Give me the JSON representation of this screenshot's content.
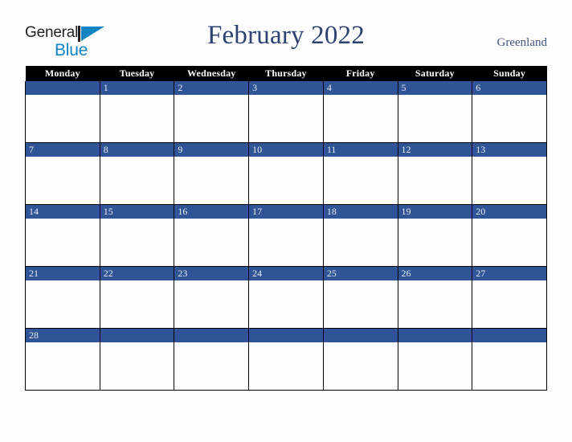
{
  "branding": {
    "logo_text_top": "General",
    "logo_text_bottom": "Blue",
    "logo_mark": "blue-triangle-icon",
    "color_dark": "#231f20",
    "color_blue": "#1283c3"
  },
  "header": {
    "title": "February 2022",
    "month": "February",
    "year": "2022",
    "country": "Greenland"
  },
  "theme": {
    "header_row_bg": "#000000",
    "header_row_text": "#ffffff",
    "date_band_bg": "#2f5597",
    "date_band_text": "#e8eaf0",
    "cell_bg": "#fdfdfd",
    "grid_line": "#000000",
    "page_bg": "#fdfdfd",
    "title_color": "#2e4272"
  },
  "calendar": {
    "weekday_headers": [
      "Monday",
      "Tuesday",
      "Wednesday",
      "Thursday",
      "Friday",
      "Saturday",
      "Sunday"
    ],
    "weeks": [
      {
        "days": [
          {
            "num": ""
          },
          {
            "num": "1"
          },
          {
            "num": "2"
          },
          {
            "num": "3"
          },
          {
            "num": "4"
          },
          {
            "num": "5"
          },
          {
            "num": "6"
          }
        ]
      },
      {
        "days": [
          {
            "num": "7"
          },
          {
            "num": "8"
          },
          {
            "num": "9"
          },
          {
            "num": "10"
          },
          {
            "num": "11"
          },
          {
            "num": "12"
          },
          {
            "num": "13"
          }
        ]
      },
      {
        "days": [
          {
            "num": "14"
          },
          {
            "num": "15"
          },
          {
            "num": "16"
          },
          {
            "num": "17"
          },
          {
            "num": "18"
          },
          {
            "num": "19"
          },
          {
            "num": "20"
          }
        ]
      },
      {
        "days": [
          {
            "num": "21"
          },
          {
            "num": "22"
          },
          {
            "num": "23"
          },
          {
            "num": "24"
          },
          {
            "num": "25"
          },
          {
            "num": "26"
          },
          {
            "num": "27"
          }
        ]
      },
      {
        "days": [
          {
            "num": "28"
          },
          {
            "num": ""
          },
          {
            "num": ""
          },
          {
            "num": ""
          },
          {
            "num": ""
          },
          {
            "num": ""
          },
          {
            "num": ""
          }
        ]
      }
    ]
  }
}
